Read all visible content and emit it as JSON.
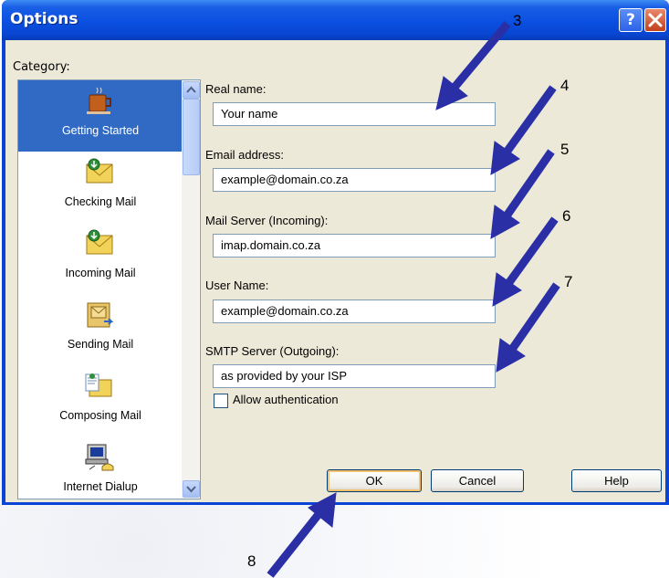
{
  "window": {
    "title": "Options",
    "help_button": "?",
    "close_button": "X"
  },
  "category": {
    "label": "Category:",
    "items": [
      {
        "label": "Getting Started",
        "icon": "coffee-cup-icon",
        "selected": true
      },
      {
        "label": "Checking Mail",
        "icon": "checking-mail-icon"
      },
      {
        "label": "Incoming Mail",
        "icon": "incoming-mail-icon"
      },
      {
        "label": "Sending Mail",
        "icon": "sending-mail-icon"
      },
      {
        "label": "Composing Mail",
        "icon": "composing-mail-icon"
      },
      {
        "label": "Internet Dialup",
        "icon": "internet-dialup-icon"
      }
    ]
  },
  "form": {
    "real_name": {
      "label": "Real name:",
      "value": "Your name"
    },
    "email": {
      "label": "Email address:",
      "value": "example@domain.co.za"
    },
    "incoming": {
      "label": "Mail Server (Incoming):",
      "value": "imap.domain.co.za"
    },
    "username": {
      "label": "User Name:",
      "value": "example@domain.co.za"
    },
    "smtp": {
      "label": "SMTP Server (Outgoing):",
      "value": "as provided by your ISP"
    },
    "allow_auth": {
      "label": "Allow authentication",
      "checked": false
    }
  },
  "buttons": {
    "ok": "OK",
    "cancel": "Cancel",
    "help": "Help"
  },
  "annotations": {
    "n3": "3",
    "n4": "4",
    "n5": "5",
    "n6": "6",
    "n7": "7",
    "n8": "8"
  },
  "colors": {
    "titlebar": "#0a4fe0",
    "selection": "#316ac5",
    "arrow": "#2b2fa6",
    "dialog_bg": "#ece9d8"
  }
}
